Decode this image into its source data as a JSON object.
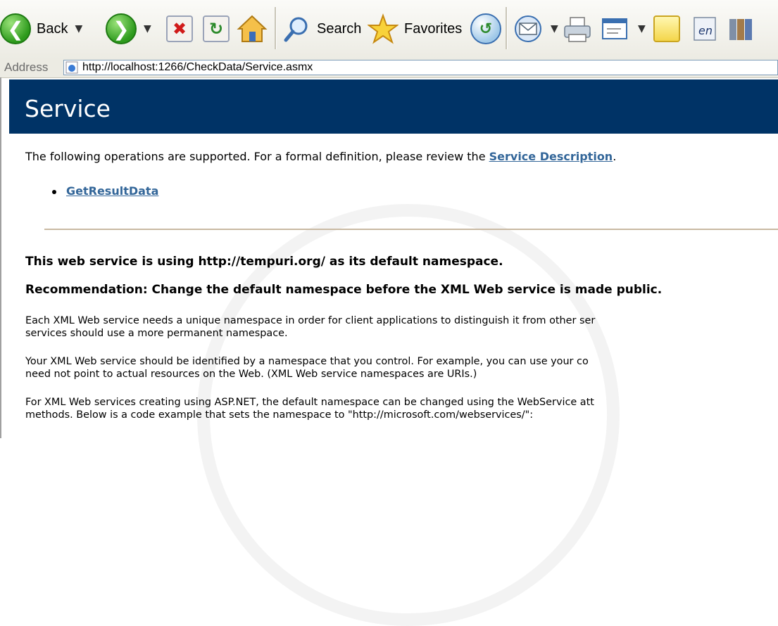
{
  "toolbar": {
    "back_label": "Back",
    "search_label": "Search",
    "favorites_label": "Favorites",
    "icons": [
      "back-icon",
      "forward-icon",
      "stop-icon",
      "refresh-icon",
      "home-icon",
      "search-icon",
      "favorites-icon",
      "history-icon",
      "mail-icon",
      "print-icon",
      "edit-icon",
      "notes-icon",
      "messenger-icon",
      "research-icon"
    ]
  },
  "address": {
    "label": "Address",
    "url": "http://localhost:1266/CheckData/Service.asmx"
  },
  "page": {
    "title": "Service",
    "intro_text": "The following operations are supported. For a formal definition, please review the ",
    "service_description_link": "Service Description",
    "intro_end": ".",
    "operations": [
      "GetResultData"
    ],
    "namespace_heading": "This web service is using http://tempuri.org/ as its default namespace.",
    "recommendation_heading": "Recommendation: Change the default namespace before the XML Web service is made public.",
    "para1_line1": "Each XML Web service needs a unique namespace in order for client applications to distinguish it from other ser",
    "para1_line2": "services should use a more permanent namespace.",
    "para2_line1": "Your XML Web service should be identified by a namespace that you control. For example, you can use your co",
    "para2_line2": "need not point to actual resources on the Web. (XML Web service namespaces are URIs.)",
    "para3_line1": "For XML Web services creating using ASP.NET, the default namespace can be changed using the WebService att",
    "para3_line2": "methods. Below is a code example that sets the namespace to \"http://microsoft.com/webservices/\":"
  },
  "colors": {
    "banner": "#003366",
    "link": "#336699",
    "rule": "#c9b9a2"
  }
}
